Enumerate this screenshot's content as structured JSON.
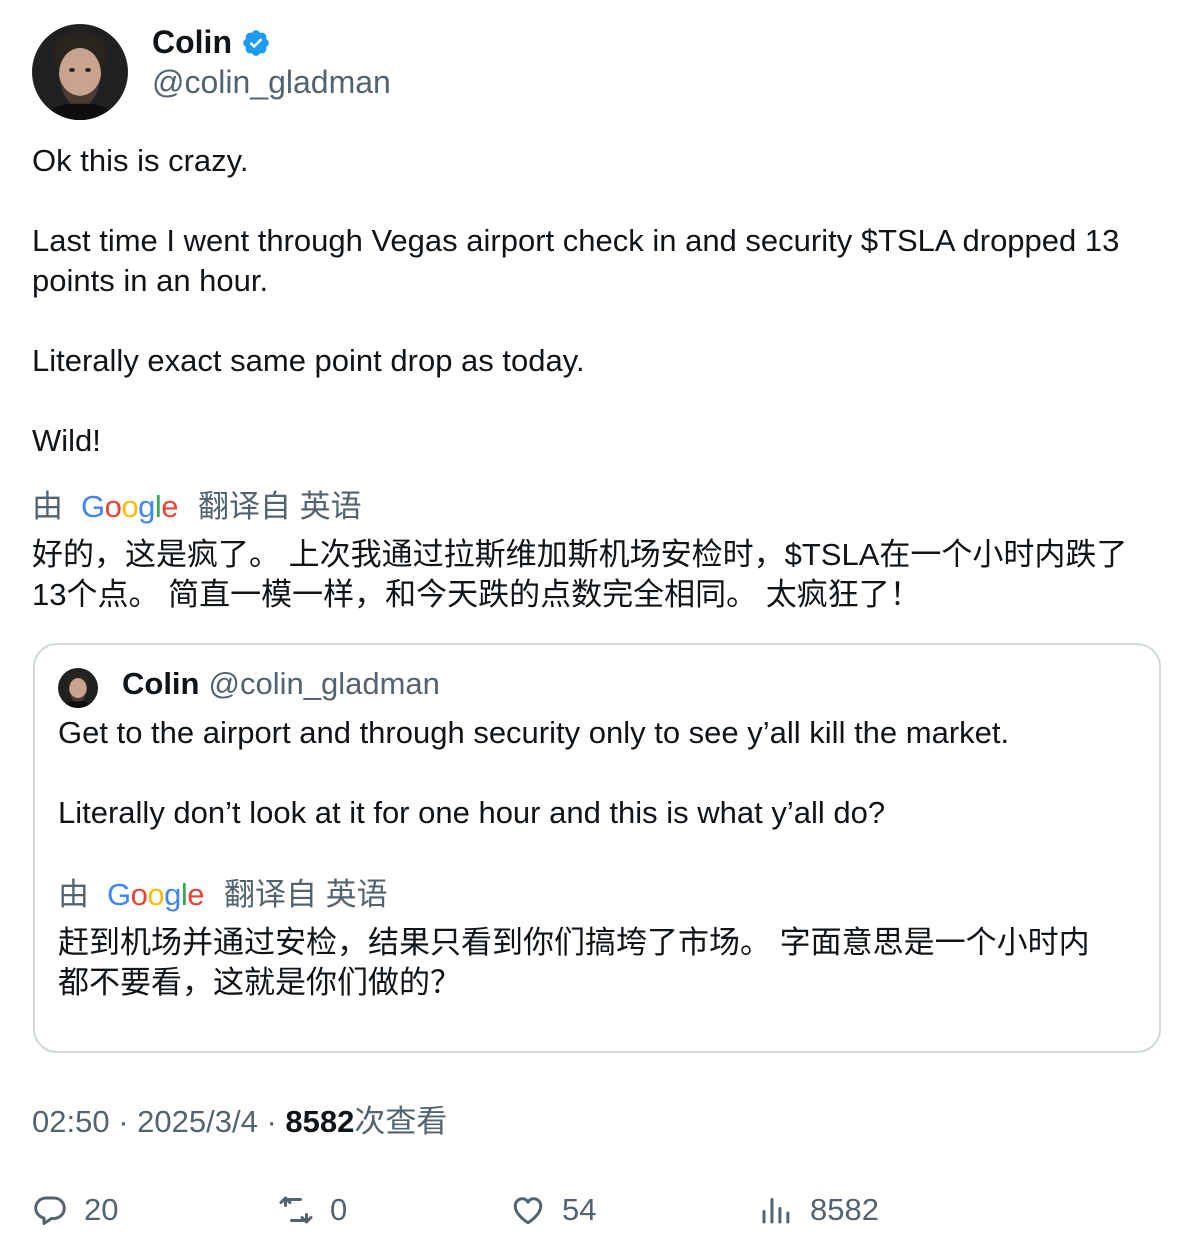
{
  "author": {
    "name": "Colin",
    "handle": "@colin_gladman",
    "verified": true
  },
  "tweet": {
    "paragraphs": [
      "Ok this is crazy.",
      "Last time I went through Vegas airport check in and security $TSLA dropped 13 points in an hour.",
      "Literally exact same point drop as today.",
      "Wild!"
    ],
    "translation_label": {
      "prefix": "由",
      "suffix": "翻译自 英语"
    },
    "translation_lines": [
      "好的，这是疯了。 上次我通过拉斯维加斯机场安检时，$TSLA在一个小时内跌了",
      "13个点。 简直一模一样，和今天跌的点数完全相同。 太疯狂了！"
    ]
  },
  "quote": {
    "name": "Colin",
    "handle": "@colin_gladman",
    "paragraphs": [
      "Get to the airport and through security only to see y’all kill the market.",
      "Literally don’t look at it for one hour and this is what y’all do?"
    ],
    "translation_label": {
      "prefix": "由",
      "suffix": "翻译自 英语"
    },
    "translation_lines": [
      "赶到机场并通过安检，结果只看到你们搞垮了市场。 字面意思是一个小时内",
      "都不要看，这就是你们做的？"
    ]
  },
  "meta": {
    "time": "02:50",
    "sep1": "·",
    "date": "2025/3/4",
    "sep2": "·",
    "views_count": "8582",
    "views_label": "次查看"
  },
  "actions": {
    "replies": "20",
    "retweets": "0",
    "likes": "54",
    "views": "8582"
  },
  "google_logo": {
    "letters": [
      "G",
      "o",
      "o",
      "g",
      "l",
      "e"
    ],
    "colors": [
      "#4285F4",
      "#EA4335",
      "#FBBC05",
      "#4285F4",
      "#34A853",
      "#EA4335"
    ]
  },
  "colors": {
    "text": "#0f1419",
    "secondary": "#536471",
    "border": "#cfd9de",
    "verified": "#1d9bf0"
  }
}
